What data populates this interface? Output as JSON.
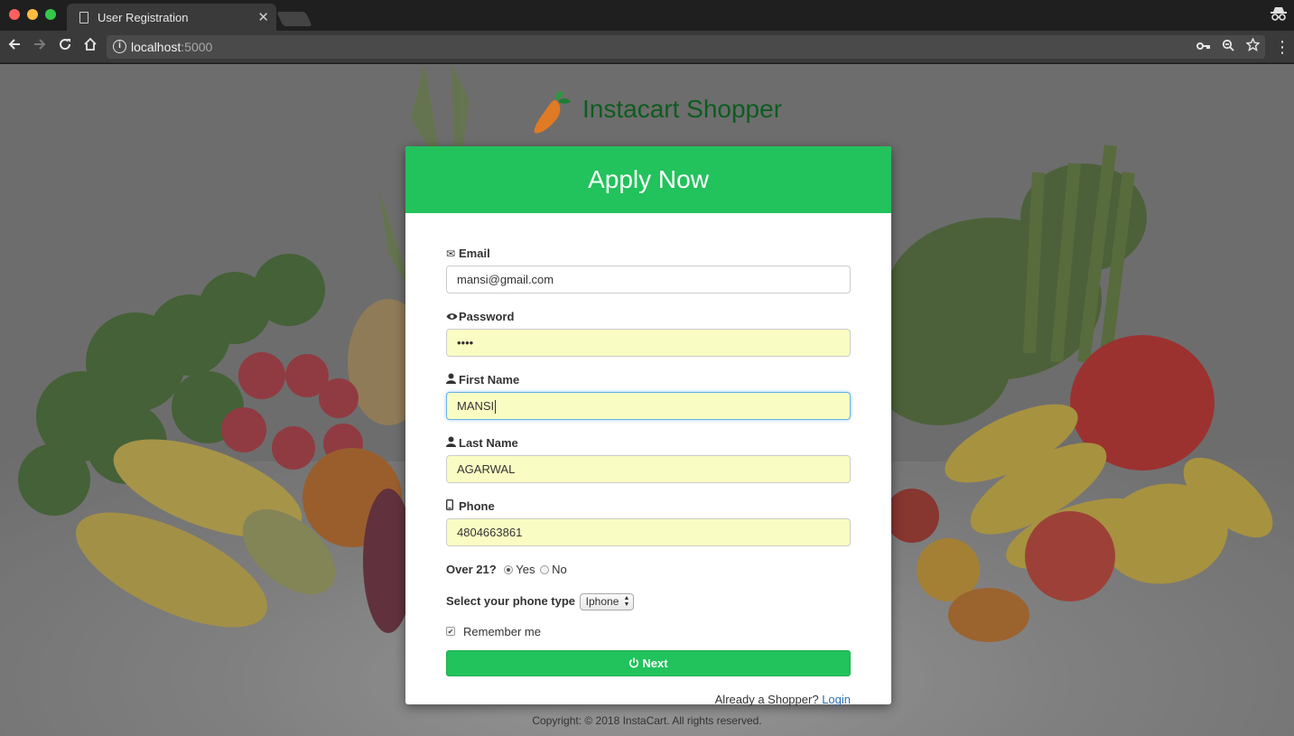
{
  "browser": {
    "tab_title": "User Registration",
    "tab_close": "✕",
    "url_host": "localhost",
    "url_port": ":5000",
    "incognito": "incognito-icon"
  },
  "brand": {
    "name": "Instacart Shopper",
    "logo": "carrot-icon",
    "color": "#0d5c1f"
  },
  "card": {
    "header": "Apply Now",
    "accent": "#22c25c"
  },
  "form": {
    "email": {
      "label": "Email",
      "icon": "envelope-icon",
      "value": "mansi@gmail.com"
    },
    "password": {
      "label": "Password",
      "icon": "eye-icon",
      "value": "••••"
    },
    "first_name": {
      "label": "First Name",
      "icon": "user-icon",
      "value": "MANSI"
    },
    "last_name": {
      "label": "Last Name",
      "icon": "user-icon",
      "value": "AGARWAL"
    },
    "phone": {
      "label": "Phone",
      "icon": "phone-icon",
      "value": "4804663861"
    },
    "over21": {
      "label": "Over 21?",
      "yes": "Yes",
      "no": "No",
      "selected": "Yes"
    },
    "phone_type": {
      "label": "Select your phone type",
      "selected": "Iphone"
    },
    "remember": {
      "label": "Remember me",
      "checked": true
    },
    "next_label": "Next",
    "login_prompt": "Already a Shopper?",
    "login_link": "Login"
  },
  "footer": {
    "copyright": "Copyright: © 2018 InstaCart. All rights reserved."
  }
}
